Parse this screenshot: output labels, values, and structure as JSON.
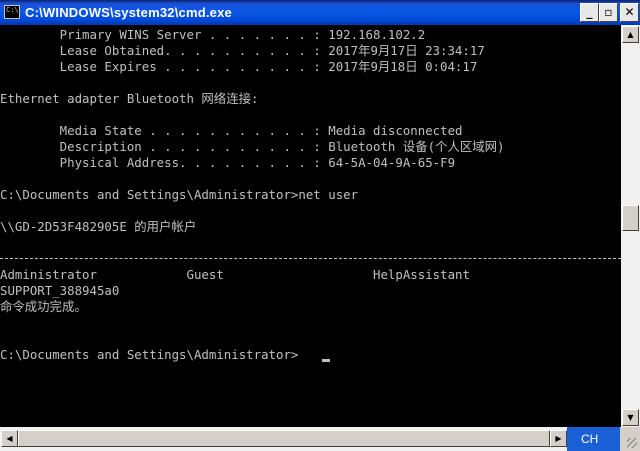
{
  "window": {
    "title": "C:\\WINDOWS\\system32\\cmd.exe",
    "icon_text": "C:\\",
    "controls": {
      "minimize": "_",
      "maximize": "▫",
      "close": "✕"
    }
  },
  "console": {
    "lines": [
      "        Primary WINS Server . . . . . . . : 192.168.102.2",
      "        Lease Obtained. . . . . . . . . . : 2017年9月17日 23:34:17",
      "        Lease Expires . . . . . . . . . . : 2017年9月18日 0:04:17",
      "",
      "Ethernet adapter Bluetooth 网络连接:",
      "",
      "        Media State . . . . . . . . . . . : Media disconnected",
      "        Description . . . . . . . . . . . : Bluetooth 设备(个人区域网)",
      "        Physical Address. . . . . . . . . : 64-5A-04-9A-65-F9",
      "",
      "C:\\Documents and Settings\\Administrator>net user",
      "",
      "\\\\GD-2D53F482905E 的用户帐户",
      "",
      "",
      "Administrator            Guest                    HelpAssistant",
      "SUPPORT_388945a0",
      "命令成功完成。",
      "",
      "",
      "C:\\Documents and Settings\\Administrator>"
    ]
  },
  "scrollbars": {
    "vertical_up": "▲",
    "vertical_down": "▼",
    "horizontal_left": "◀",
    "horizontal_right": "▶"
  },
  "ime": {
    "label": "CH"
  }
}
